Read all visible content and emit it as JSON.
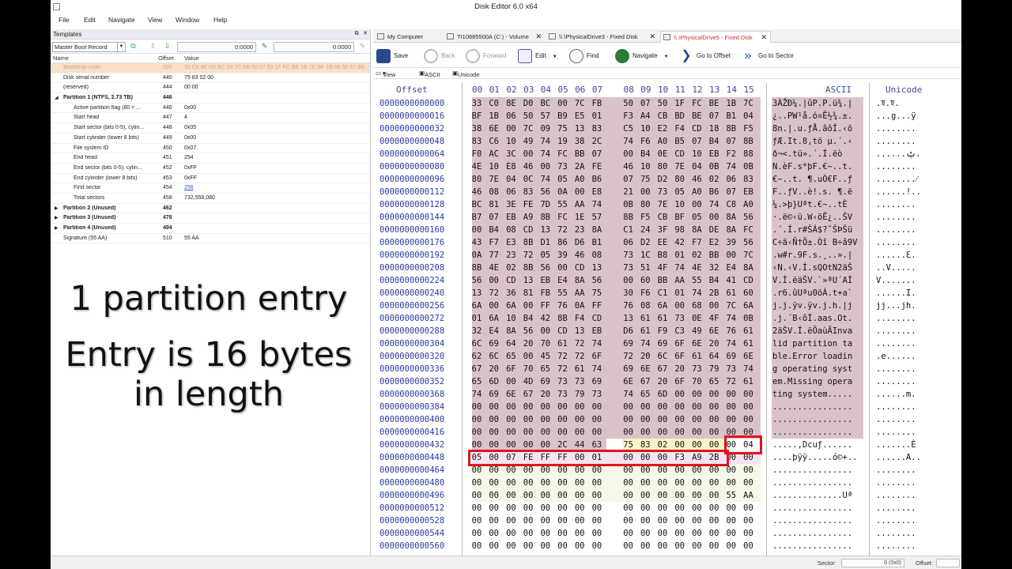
{
  "window": {
    "title": "Disk Editor 6.0 x64"
  },
  "menu": [
    "File",
    "Edit",
    "Navigate",
    "View",
    "Window",
    "Help"
  ],
  "templates": {
    "header": "Templates",
    "selected": "Master Boot Record",
    "offset_value": "0:0000",
    "offset_value2": "0:0000",
    "columns": {
      "name": "Name",
      "offset": "Offset",
      "value": "Value"
    },
    "rows": [
      {
        "name": "Bootstrap code",
        "offset": "000",
        "value": "33 C0 8E D0 BC 00 7C FB 50 07 50 1F FC BE 1B 7C BF 1B 06 50 57 B9"
      },
      {
        "name": "Disk serial number",
        "offset": "440",
        "value": "75 83 02 00"
      },
      {
        "name": "(reserved)",
        "offset": "444",
        "value": "00 00"
      },
      {
        "name": "Partition 1 (NTFS, 2.73 TB)",
        "offset": "446",
        "value": ""
      },
      {
        "name": "Active partition flag (80 = ...",
        "offset": "446",
        "value": "0x00"
      },
      {
        "name": "Start head",
        "offset": "447",
        "value": "4"
      },
      {
        "name": "Start sector (bits 0-5), cylin...",
        "offset": "448",
        "value": "0x05"
      },
      {
        "name": "Start cylinder (lower 8 bits)",
        "offset": "449",
        "value": "0x00"
      },
      {
        "name": "File system ID",
        "offset": "450",
        "value": "0x07"
      },
      {
        "name": "End head",
        "offset": "451",
        "value": "254"
      },
      {
        "name": "End sector (bits 0-5), cylin...",
        "offset": "452",
        "value": "0xFF"
      },
      {
        "name": "End cylinder (lower 8 bits)",
        "offset": "453",
        "value": "0xFF"
      },
      {
        "name": "First sector",
        "offset": "454",
        "value": "256"
      },
      {
        "name": "Total sectors",
        "offset": "458",
        "value": "732,558,080"
      },
      {
        "name": "Partition 2 (Unused)",
        "offset": "462",
        "value": ""
      },
      {
        "name": "Partition 3 (Unused)",
        "offset": "478",
        "value": ""
      },
      {
        "name": "Partition 4 (Unused)",
        "offset": "494",
        "value": ""
      },
      {
        "name": "Signature (55 AA)",
        "offset": "510",
        "value": "55 AA"
      }
    ]
  },
  "caption": {
    "line1": "1 partition entry",
    "line2": "Entry is 16 bytes",
    "line3": "in length"
  },
  "tabs": [
    {
      "label": "My Computer"
    },
    {
      "label": "TI10685500A (C:) - Volume"
    },
    {
      "label": "\\\\.\\PhysicalDrive3 - Fixed Disk"
    },
    {
      "label": "\\\\.\\PhysicalDrive5 - Fixed Disk"
    }
  ],
  "toolbar": {
    "save": "Save",
    "back": "Back",
    "forward": "Forward",
    "edit": "Edit",
    "find": "Find",
    "navigate": "Navigate",
    "go_offset": "Go to Offset",
    "go_sector": "Go to Sector"
  },
  "subtoolbar": {
    "view": "View",
    "ascii": "ASCII",
    "unicode": "Unicode"
  },
  "hex": {
    "offset_header": "Offset",
    "byte_headers": [
      "00",
      "01",
      "02",
      "03",
      "04",
      "05",
      "06",
      "07",
      "08",
      "09",
      "10",
      "11",
      "12",
      "13",
      "14",
      "15"
    ],
    "ascii_header": "ASCII",
    "unicode_header": "Unicode",
    "offsets": [
      "0000000000000",
      "0000000000016",
      "0000000000032",
      "0000000000048",
      "0000000000064",
      "0000000000080",
      "0000000000096",
      "0000000000112",
      "0000000000128",
      "0000000000144",
      "0000000000160",
      "0000000000176",
      "0000000000192",
      "0000000000208",
      "0000000000224",
      "0000000000240",
      "0000000000256",
      "0000000000272",
      "0000000000288",
      "0000000000304",
      "0000000000320",
      "0000000000336",
      "0000000000352",
      "0000000000368",
      "0000000000384",
      "0000000000400",
      "0000000000416",
      "0000000000432",
      "0000000000448",
      "0000000000464",
      "0000000000480",
      "0000000000496",
      "0000000000512",
      "0000000000528",
      "0000000000544",
      "0000000000560"
    ],
    "rows": [
      "33 C0 8E D0 BC 00 7C FB 50 07 50 1F FC BE 1B 7C",
      "BF 1B 06 50 57 B9 E5 01 F3 A4 CB BD BE 07 B1 04",
      "38 6E 00 7C 09 75 13 83 C5 10 E2 F4 CD 18 8B F5",
      "83 C6 10 49 74 19 38 2C 74 F6 A0 B5 07 B4 07 8B",
      "F0 AC 3C 00 74 FC BB 07 00 B4 0E CD 10 EB F2 88",
      "4E 10 E8 46 00 73 2A FE 46 10 80 7E 04 0B 74 0B",
      "80 7E 04 0C 74 05 A0 B6 07 75 D2 80 46 02 06 83",
      "46 08 06 83 56 0A 00 E8 21 00 73 05 A0 B6 07 EB",
      "BC 81 3E FE 7D 55 AA 74 0B 80 7E 10 00 74 C8 A0",
      "B7 07 EB A9 8B FC 1E 57 8B F5 CB BF 05 00 8A 56",
      "00 B4 08 CD 13 72 23 8A C1 24 3F 98 8A DE 8A FC",
      "43 F7 E3 8B D1 86 D6 B1 06 D2 EE 42 F7 E2 39 56",
      "0A 77 23 72 05 39 46 08 73 1C B8 01 02 BB 00 7C",
      "8B 4E 02 8B 56 00 CD 13 73 51 4F 74 4E 32 E4 8A",
      "56 00 CD 13 EB E4 8A 56 00 60 BB AA 55 B4 41 CD",
      "13 72 36 81 FB 55 AA 75 30 F6 C1 01 74 2B 61 60",
      "6A 00 6A 00 FF 76 0A FF 76 08 6A 00 68 00 7C 6A",
      "01 6A 10 B4 42 8B F4 CD 13 61 61 73 0E 4F 74 0B",
      "32 E4 8A 56 00 CD 13 EB D6 61 F9 C3 49 6E 76 61",
      "6C 69 64 20 70 61 72 74 69 74 69 6F 6E 20 74 61",
      "62 6C 65 00 45 72 72 6F 72 20 6C 6F 61 64 69 6E",
      "67 20 6F 70 65 72 61 74 69 6E 67 20 73 79 73 74",
      "65 6D 00 4D 69 73 73 69 6E 67 20 6F 70 65 72 61",
      "74 69 6E 67 20 73 79 73 74 65 6D 00 00 00 00 00",
      "00 00 00 00 00 00 00 00 00 00 00 00 00 00 00 00",
      "00 00 00 00 00 00 00 00 00 00 00 00 00 00 00 00",
      "00 00 00 00 00 00 00 00 00 00 00 00 00 00 00 00",
      "00 00 00 00 00 2C 44 63 75 83 02 00 00 00 00 04",
      "05 00 07 FE FF FF 00 01 00 00 00 F3 A9 2B 00 00",
      "00 00 00 00 00 00 00 00 00 00 00 00 00 00 00 00",
      "00 00 00 00 00 00 00 00 00 00 00 00 00 00 00 00",
      "00 00 00 00 00 00 00 00 00 00 00 00 00 00 55 AA",
      "00 00 00 00 00 00 00 00 00 00 00 00 00 00 00 00",
      "00 00 00 00 00 00 00 00 00 00 00 00 00 00 00 00",
      "00 00 00 00 00 00 00 00 00 00 00 00 00 00 00 00",
      "00 00 00 00 00 00 00 00 00 00 00 00 00 00 00 00"
    ],
    "ascii": [
      "3ÀŽÐ¼.|ûP.P.ü¾.|",
      "¿..PW¹å.ó¤Ë½¾.±.",
      "8n.|.u.ƒÅ.âôÍ.‹õ",
      "ƒÆ.It.8,tö µ.´.‹",
      "ð¬<.tü».´.Í.ëò",
      "N.èF.s*þF.€~..t.",
      "€~..t. ¶.uÒ€F..ƒ",
      "F..ƒV..è!.s. ¶.ë",
      "¼.>þ}Uªt.€~..tÈ ",
      "·.ë©‹ü.W‹õË¿..ŠV",
      ".´.Í.r#ŠÁ$?˜ŠÞŠü",
      "C÷ã‹Ñ†Ö±.Òî B÷â9V",
      ".w#r.9F.s.¸..».|",
      "‹N.‹V.Í.sQOtN2äŠ",
      "V.Í.ëäŠV.`»ªU´AÍ",
      ".r6.ûUªu0öÁ.t+a`",
      "j.j.ÿv.ÿv.j.h.|j",
      ".j.´B‹ôÍ.aas.Ot.",
      "2äŠV.Í.ëÖaùÃInva",
      "lid partition ta",
      "ble.Error loadin",
      "g operating syst",
      "em.Missing opera",
      "ting system.....",
      "................",
      "................",
      "................",
      ".....,Dcuƒ......",
      "....þÿÿ.....ó©+..",
      "................",
      "................",
      "..............Uª",
      "................",
      "................",
      "................",
      "................"
    ],
    "unicode": [
      ".ꠁ.ꠁ.",
      "...g...ÿ",
      "........",
      "........",
      "......ݑ.",
      "........",
      "........⁄",
      "......!..",
      "........",
      "........",
      "........",
      "........",
      "......Ɛ.",
      "..V.....",
      "V.......",
      "......I.",
      "jj...jh.",
      "........",
      "........",
      "........",
      ".e......",
      "........",
      "........",
      "......m.",
      "........",
      "........",
      "........",
      ".......È",
      "......A..",
      "........",
      "........",
      "........",
      "........",
      "........",
      "........",
      "........"
    ]
  },
  "statusbar": {
    "sector_label": "Sector:",
    "sector_value": "0 (0x0)",
    "offset_label": "Offset:"
  }
}
